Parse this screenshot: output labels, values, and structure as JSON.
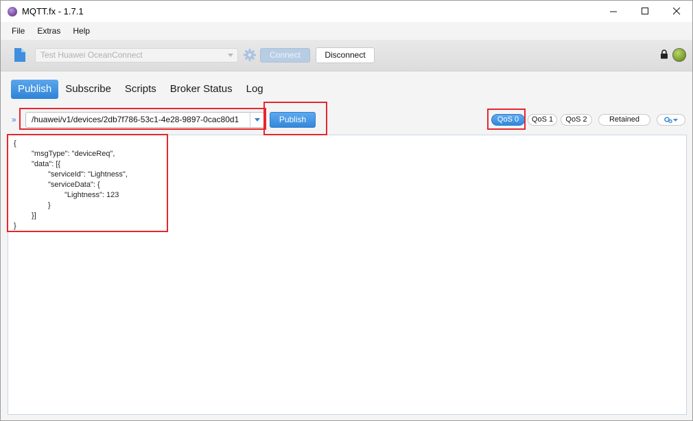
{
  "window": {
    "title": "MQTT.fx - 1.7.1"
  },
  "menu": {
    "items": [
      "File",
      "Extras",
      "Help"
    ]
  },
  "connection": {
    "profile": "Test Huawei OceanConnect",
    "connect_label": "Connect",
    "disconnect_label": "Disconnect",
    "status_color": "#7fa52c"
  },
  "tabs": [
    {
      "label": "Publish",
      "active": true
    },
    {
      "label": "Subscribe",
      "active": false
    },
    {
      "label": "Scripts",
      "active": false
    },
    {
      "label": "Broker Status",
      "active": false
    },
    {
      "label": "Log",
      "active": false
    }
  ],
  "publish": {
    "topic": "/huawei/v1/devices/2db7f786-53c1-4e28-9897-0cac80d1",
    "publish_label": "Publish",
    "qos": [
      {
        "label": "QoS 0",
        "selected": true
      },
      {
        "label": "QoS 1",
        "selected": false
      },
      {
        "label": "QoS 2",
        "selected": false
      }
    ],
    "retained_label": "Retained",
    "payload_lines": [
      "{",
      "\"msgType\": \"deviceReq\",",
      "\"data\": [{",
      "\"serviceId\": \"Lightness\",",
      "\"serviceData\": {",
      "\"Lightness\": 123",
      "}",
      "}]",
      "}"
    ]
  },
  "colors": {
    "accent": "#2f83d7",
    "annotation": "#e5262d"
  }
}
